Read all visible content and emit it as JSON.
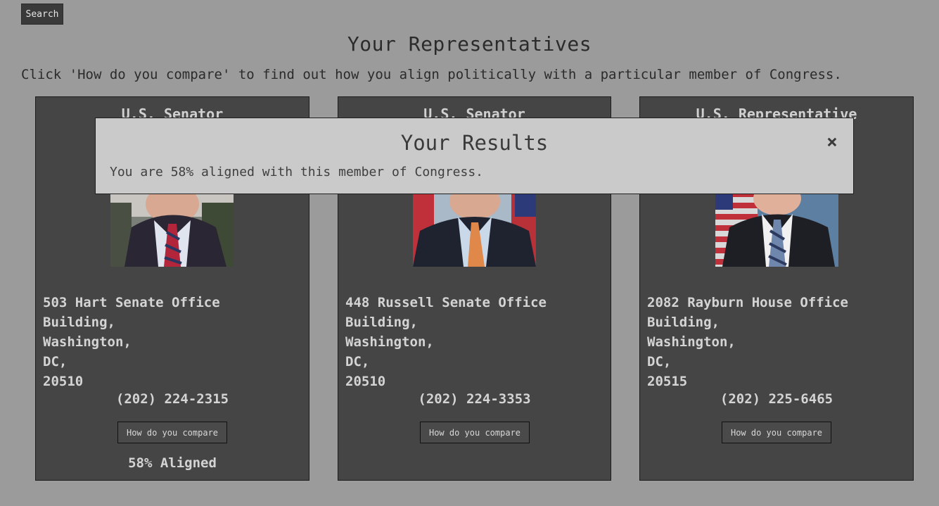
{
  "search": {
    "label": "Search"
  },
  "page": {
    "title": "Your Representatives",
    "intro": "Click 'How do you compare' to find out how you align politically with a particular member of Congress."
  },
  "cards": [
    {
      "role": "U.S. Senator",
      "address": [
        "503 Hart Senate Office",
        "Building,",
        "Washington,",
        "DC,",
        "20510"
      ],
      "phone": "(202) 224-2315",
      "compare_label": "How do you compare",
      "aligned": "58% Aligned"
    },
    {
      "role": "U.S. Senator",
      "address": [
        "448 Russell Senate Office",
        "Building,",
        "Washington,",
        "DC,",
        "20510"
      ],
      "phone": "(202) 224-3353",
      "compare_label": "How do you compare",
      "aligned": ""
    },
    {
      "role": "U.S. Representative",
      "address": [
        "2082 Rayburn House Office",
        "Building,",
        "Washington,",
        "DC,",
        "20515"
      ],
      "phone": "(202) 225-6465",
      "compare_label": "How do you compare",
      "aligned": ""
    }
  ],
  "modal": {
    "title": "Your Results",
    "close_icon": "×",
    "text": "You are 58% aligned with this member of Congress."
  },
  "colors": {
    "background": "#9b9b9b",
    "card": "#454545",
    "modal": "#cbcaca",
    "card_text": "#d4d4d4"
  }
}
